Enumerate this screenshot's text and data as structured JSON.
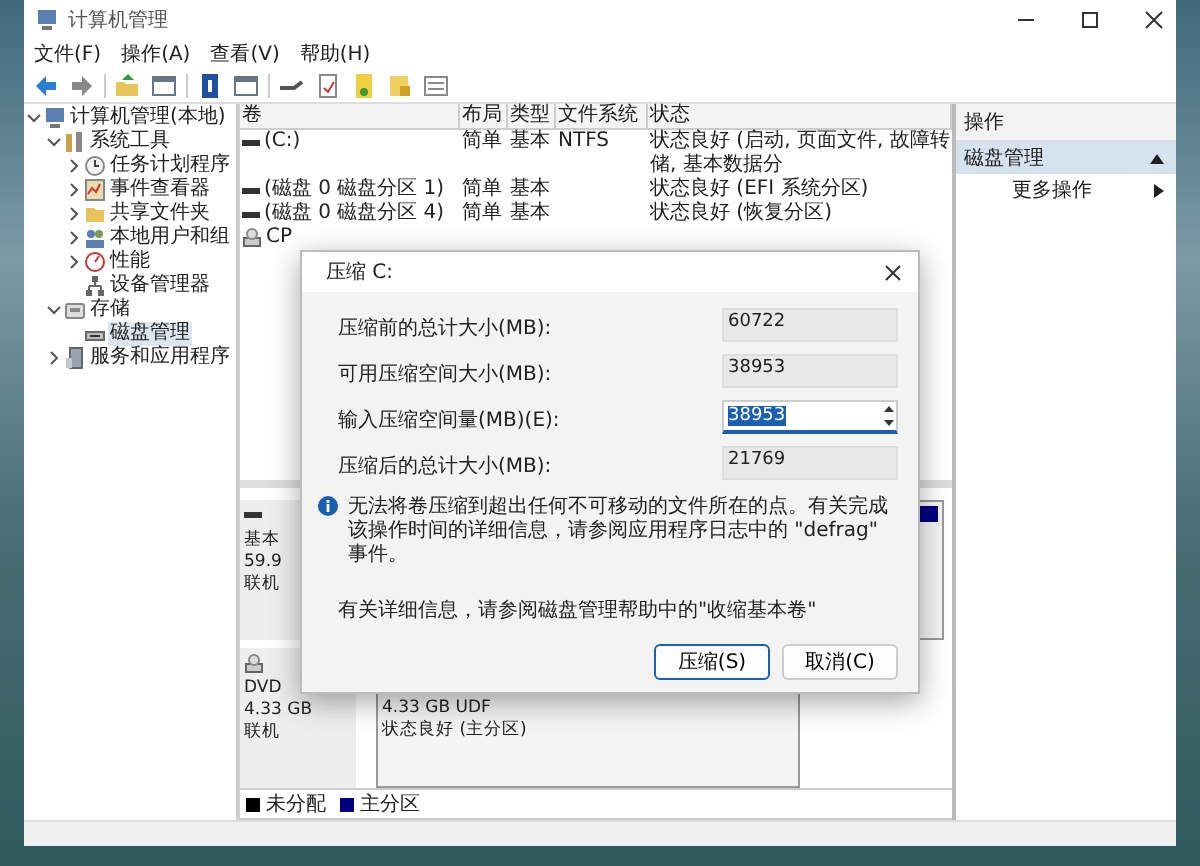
{
  "window": {
    "title": "计算机管理"
  },
  "menu": [
    "文件(F)",
    "操作(A)",
    "查看(V)",
    "帮助(H)"
  ],
  "tree": [
    {
      "label": "计算机管理(本地)",
      "expanded": true,
      "selected": false,
      "children": [
        {
          "label": "系统工具",
          "expanded": true,
          "selected": false,
          "children": [
            {
              "label": "任务计划程序",
              "expanded": false,
              "selected": false
            },
            {
              "label": "事件查看器",
              "expanded": false,
              "selected": false
            },
            {
              "label": "共享文件夹",
              "expanded": false,
              "selected": false
            },
            {
              "label": "本地用户和组",
              "expanded": false,
              "selected": false
            },
            {
              "label": "性能",
              "expanded": false,
              "selected": false
            },
            {
              "label": "设备管理器",
              "selected": false
            }
          ]
        },
        {
          "label": "存储",
          "expanded": true,
          "selected": false,
          "children": [
            {
              "label": "磁盘管理",
              "selected": true
            }
          ]
        },
        {
          "label": "服务和应用程序",
          "expanded": false,
          "selected": false
        }
      ]
    }
  ],
  "volumes": {
    "columns": [
      "卷",
      "布局",
      "类型",
      "文件系统",
      "状态"
    ],
    "rows": [
      {
        "kind": "volume",
        "cells": [
          "(C:)",
          "简单",
          "基本",
          "NTFS",
          "状态良好 (启动, 页面文件, 故障转储, 基本数据分"
        ]
      },
      {
        "kind": "volume",
        "cells": [
          "(磁盘 0 磁盘分区 1)",
          "简单",
          "基本",
          "",
          "状态良好 (EFI 系统分区)"
        ]
      },
      {
        "kind": "volume",
        "cells": [
          "(磁盘 0 磁盘分区 4)",
          "简单",
          "基本",
          "",
          "状态良好 (恢复分区)"
        ]
      },
      {
        "kind": "optical",
        "cells": [
          "CP",
          "",
          "",
          "",
          ""
        ]
      }
    ]
  },
  "disks": [
    {
      "kind": "volume",
      "lines": [
        "基本",
        "59.9",
        "联机"
      ],
      "partitions": [
        {
          "kind": "primary"
        }
      ]
    },
    {
      "kind": "optical",
      "lines": [
        "DVD",
        "4.33 GB",
        "联机"
      ],
      "partitions": [
        {
          "kind": "primary",
          "lines": [
            "4.33 GB UDF",
            "状态良好 (主分区)"
          ]
        }
      ]
    }
  ],
  "legend": [
    {
      "label": "未分配",
      "color": "#000000"
    },
    {
      "label": "主分区",
      "color": "#000080"
    }
  ],
  "actions": {
    "header": "操作",
    "section": {
      "label": "磁盘管理",
      "selected": true
    },
    "items": [
      {
        "label": "更多操作"
      }
    ]
  },
  "dialog": {
    "title": "压缩 C:",
    "fields": [
      {
        "label": "压缩前的总计大小(MB):",
        "value": "60722",
        "kind": "readonly"
      },
      {
        "label": "可用压缩空间大小(MB):",
        "value": "38953",
        "kind": "readonly"
      },
      {
        "label": "输入压缩空间量(MB)(E):",
        "value": "38953",
        "kind": "spin"
      },
      {
        "label": "压缩后的总计大小(MB):",
        "value": "21769",
        "kind": "readonly"
      }
    ],
    "info": "无法将卷压缩到超出任何不可移动的文件所在的点。有关完成该操作时间的详细信息，请参阅应用程序日志中的 \"defrag\" 事件。",
    "help": "有关详细信息，请参阅磁盘管理帮助中的\"收缩基本卷\"",
    "buttons": [
      {
        "label": "压缩(S)",
        "primary": true
      },
      {
        "label": "取消(C)",
        "primary": false
      }
    ]
  }
}
